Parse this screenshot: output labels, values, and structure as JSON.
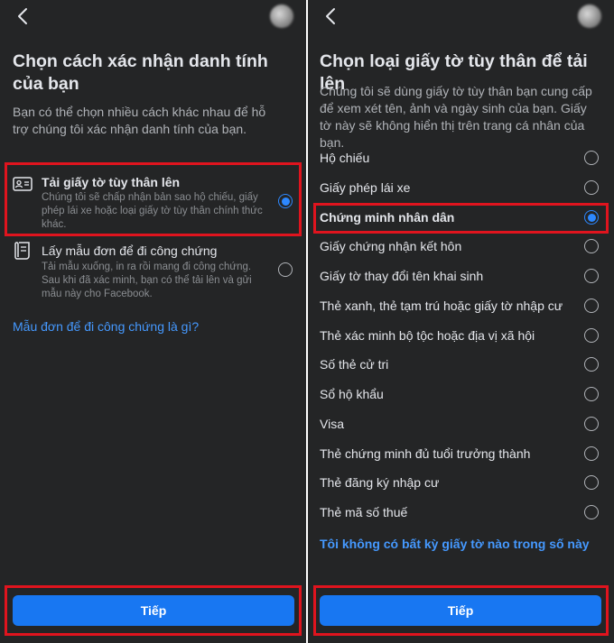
{
  "left": {
    "title": "Chọn cách xác nhận danh tính của bạn",
    "description": "Bạn có thể chọn nhiều cách khác nhau để hỗ trợ chúng tôi xác nhận danh tính của bạn.",
    "options": [
      {
        "title": "Tải giấy tờ tùy thân lên",
        "subtitle": "Chúng tôi sẽ chấp nhận bản sao hộ chiếu, giấy phép lái xe hoặc loại giấy tờ tùy thân chính thức khác.",
        "icon": "id-card-icon",
        "selected": true
      },
      {
        "title": "Lấy mẫu đơn để đi công chứng",
        "subtitle": "Tải mẫu xuống, in ra rồi mang đi công chứng. Sau khi đã xác minh, bạn có thể tải lên và gửi mẫu này cho Facebook.",
        "icon": "document-icon",
        "selected": false
      }
    ],
    "help_link": "Mẫu đơn để đi công chứng là gì?",
    "next_button": "Tiếp"
  },
  "right": {
    "title": "Chọn loại giấy tờ tùy thân để tải lên",
    "description": "Chúng tôi sẽ dùng giấy tờ tùy thân bạn cung cấp để xem xét tên, ảnh và ngày sinh của bạn. Giấy tờ này sẽ không hiển thị trên trang cá nhân của bạn.",
    "documents": [
      {
        "label": "Hộ chiếu",
        "selected": false
      },
      {
        "label": "Giấy phép lái xe",
        "selected": false
      },
      {
        "label": "Chứng minh nhân dân",
        "selected": true
      },
      {
        "label": "Giấy chứng nhận kết hôn",
        "selected": false
      },
      {
        "label": "Giấy tờ thay đổi tên khai sinh",
        "selected": false
      },
      {
        "label": "Thẻ xanh, thẻ tạm trú hoặc giấy tờ nhập cư",
        "selected": false
      },
      {
        "label": "Thẻ xác minh bộ tộc hoặc địa vị xã hội",
        "selected": false
      },
      {
        "label": "Số thẻ cử tri",
        "selected": false
      },
      {
        "label": "Sổ hộ khẩu",
        "selected": false
      },
      {
        "label": "Visa",
        "selected": false
      },
      {
        "label": "Thẻ chứng minh đủ tuổi trưởng thành",
        "selected": false
      },
      {
        "label": "Thẻ đăng ký nhập cư",
        "selected": false
      },
      {
        "label": "Thẻ mã số thuế",
        "selected": false
      }
    ],
    "no_document_link": "Tôi không có bất kỳ giấy tờ nào trong số này",
    "next_button": "Tiếp"
  },
  "colors": {
    "background": "#242526",
    "accent": "#2d88ff",
    "button": "#1877f2",
    "link": "#4599ff",
    "highlight": "#e0141e"
  }
}
